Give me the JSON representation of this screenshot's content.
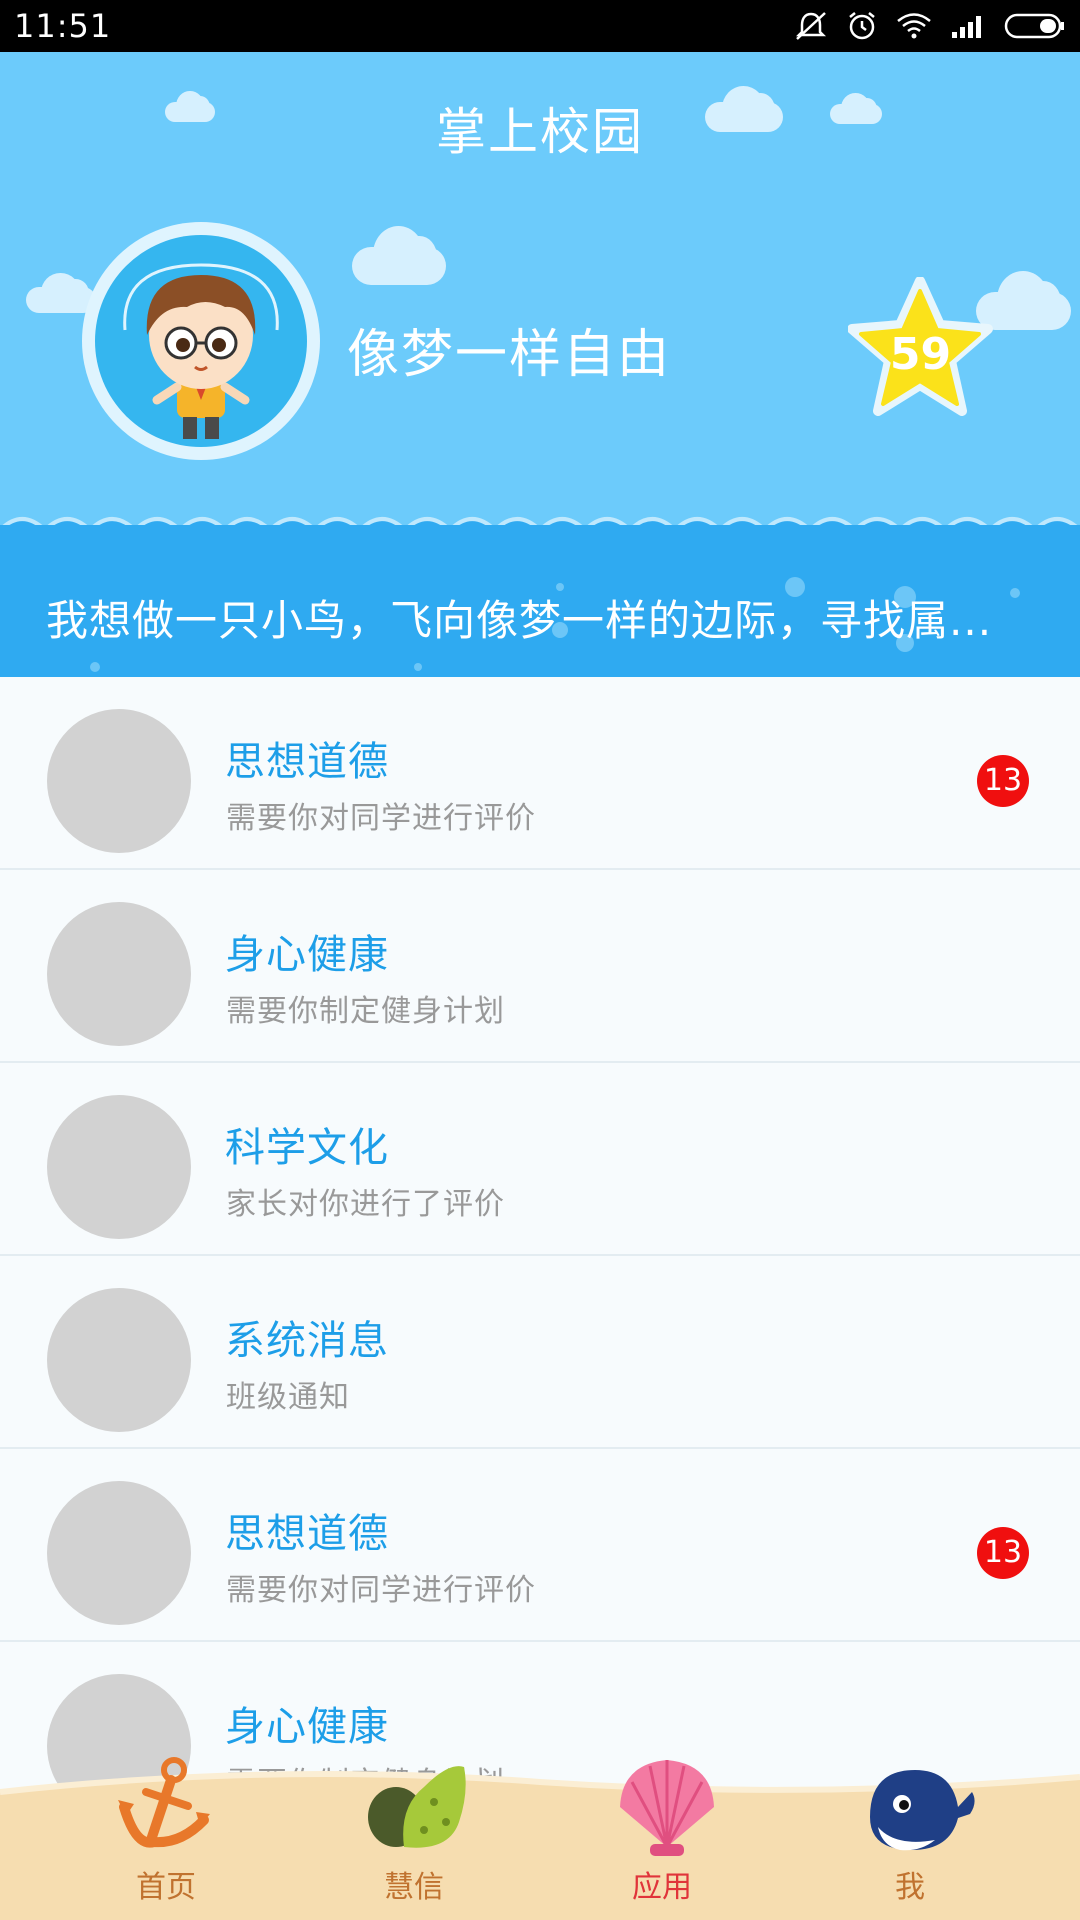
{
  "status_bar": {
    "time": "11:51"
  },
  "header": {
    "title": "掌上校园",
    "username": "像梦一样自由",
    "star_count": "59",
    "motto": "我想做一只小鸟，飞向像梦一样的边际，寻找属..."
  },
  "list": {
    "items": [
      {
        "title": "思想道德",
        "subtitle": "需要你对同学进行评价",
        "badge": "13"
      },
      {
        "title": "身心健康",
        "subtitle": "需要你制定健身计划",
        "badge": ""
      },
      {
        "title": "科学文化",
        "subtitle": "家长对你进行了评价",
        "badge": ""
      },
      {
        "title": "系统消息",
        "subtitle": "班级通知",
        "badge": ""
      },
      {
        "title": "思想道德",
        "subtitle": "需要你对同学进行评价",
        "badge": "13"
      },
      {
        "title": "身心健康",
        "subtitle": "需要你制定健身计划",
        "badge": ""
      }
    ]
  },
  "tabbar": {
    "tabs": [
      {
        "label": "首页",
        "icon": "anchor-icon"
      },
      {
        "label": "慧信",
        "icon": "conch-icon"
      },
      {
        "label": "应用",
        "icon": "shell-icon",
        "active": true
      },
      {
        "label": "我",
        "icon": "whale-icon"
      }
    ]
  },
  "colors": {
    "header_bg": "#6ccbfb",
    "wave_band": "#2faaf1",
    "title_blue": "#1d9ee8",
    "badge_red": "#f00f0f",
    "tab_label": "#c0722f",
    "tab_label_active": "#e0343a"
  }
}
